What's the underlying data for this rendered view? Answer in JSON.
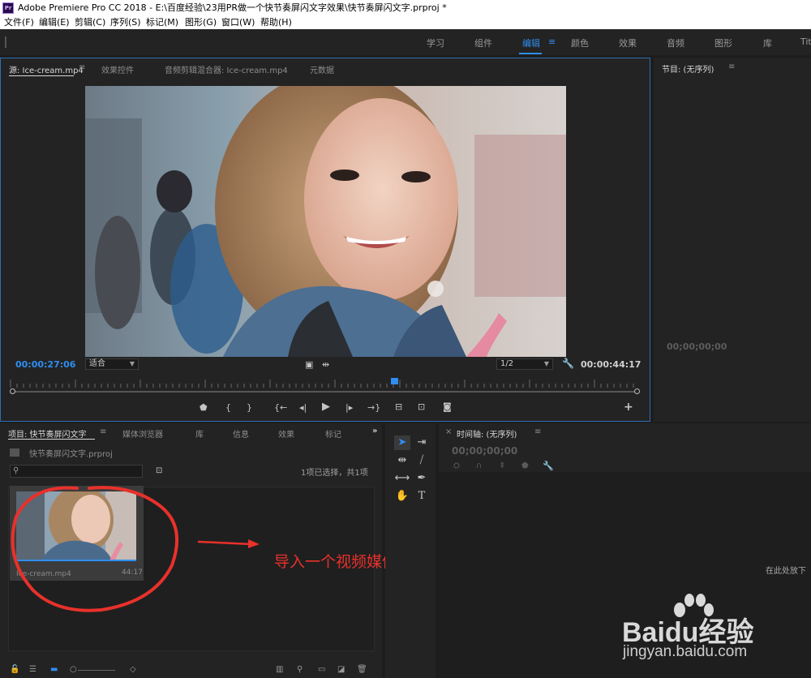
{
  "window": {
    "title": "Adobe Premiere Pro CC 2018 - E:\\百度经验\\23用PR做一个快节奏屏闪文字效果\\快节奏屏闪文字.prproj *",
    "logo": "Pr"
  },
  "menu": [
    "文件(F)",
    "编辑(E)",
    "剪辑(C)",
    "序列(S)",
    "标记(M)",
    "图形(G)",
    "窗口(W)",
    "帮助(H)"
  ],
  "workspaces": [
    "学习",
    "组件",
    "编辑",
    "颜色",
    "效果",
    "音频",
    "图形",
    "库",
    "Tit"
  ],
  "active_workspace": "编辑",
  "source_panel": {
    "tabs": [
      "源: Ice-cream.mp4",
      "效果控件",
      "音频剪辑混合器: Ice-cream.mp4",
      "元数据"
    ],
    "timecode_current": "00:00:27:06",
    "timecode_duration": "00:00:44:17",
    "zoom_select": "适合",
    "resolution_select": "1/2",
    "playhead_position": 0.61
  },
  "program_panel": {
    "tab": "节目: (无序列)",
    "timecode": "00;00;00;00"
  },
  "project_panel": {
    "tabs": [
      "项目: 快节奏屏闪文字",
      "媒体浏览器",
      "库",
      "信息",
      "效果",
      "标记"
    ],
    "project_file": "快节奏屏闪文字.prproj",
    "selection_info": "1项已选择，共1项",
    "search_placeholder": "",
    "clip": {
      "name": "Ice-cream.mp4",
      "duration": "44:17"
    }
  },
  "timeline_panel": {
    "tab": "时间轴: (无序列)",
    "timecode": "00;00;00;00",
    "drop_hint": "在此处放下"
  },
  "annotation_text": "导入一个视频媒体",
  "watermark": {
    "brand": "Baidu经验",
    "url": "jingyan.baidu.com"
  },
  "icons": [
    "menu-icon",
    "wrench-icon",
    "play-icon",
    "step-back-icon",
    "step-forward-icon",
    "insert-icon",
    "overwrite-icon",
    "camera-icon",
    "plus-icon",
    "selection-tool-icon",
    "ripple-edit-icon",
    "razor-icon",
    "slip-icon",
    "pen-icon",
    "hand-icon",
    "type-icon",
    "lock-icon",
    "list-view-icon",
    "icon-view-icon",
    "new-bin-icon",
    "new-item-icon",
    "trash-icon",
    "search-icon"
  ],
  "colors": {
    "accent": "#2f8ef0",
    "annotation": "#e8312b",
    "panel": "#232323"
  }
}
